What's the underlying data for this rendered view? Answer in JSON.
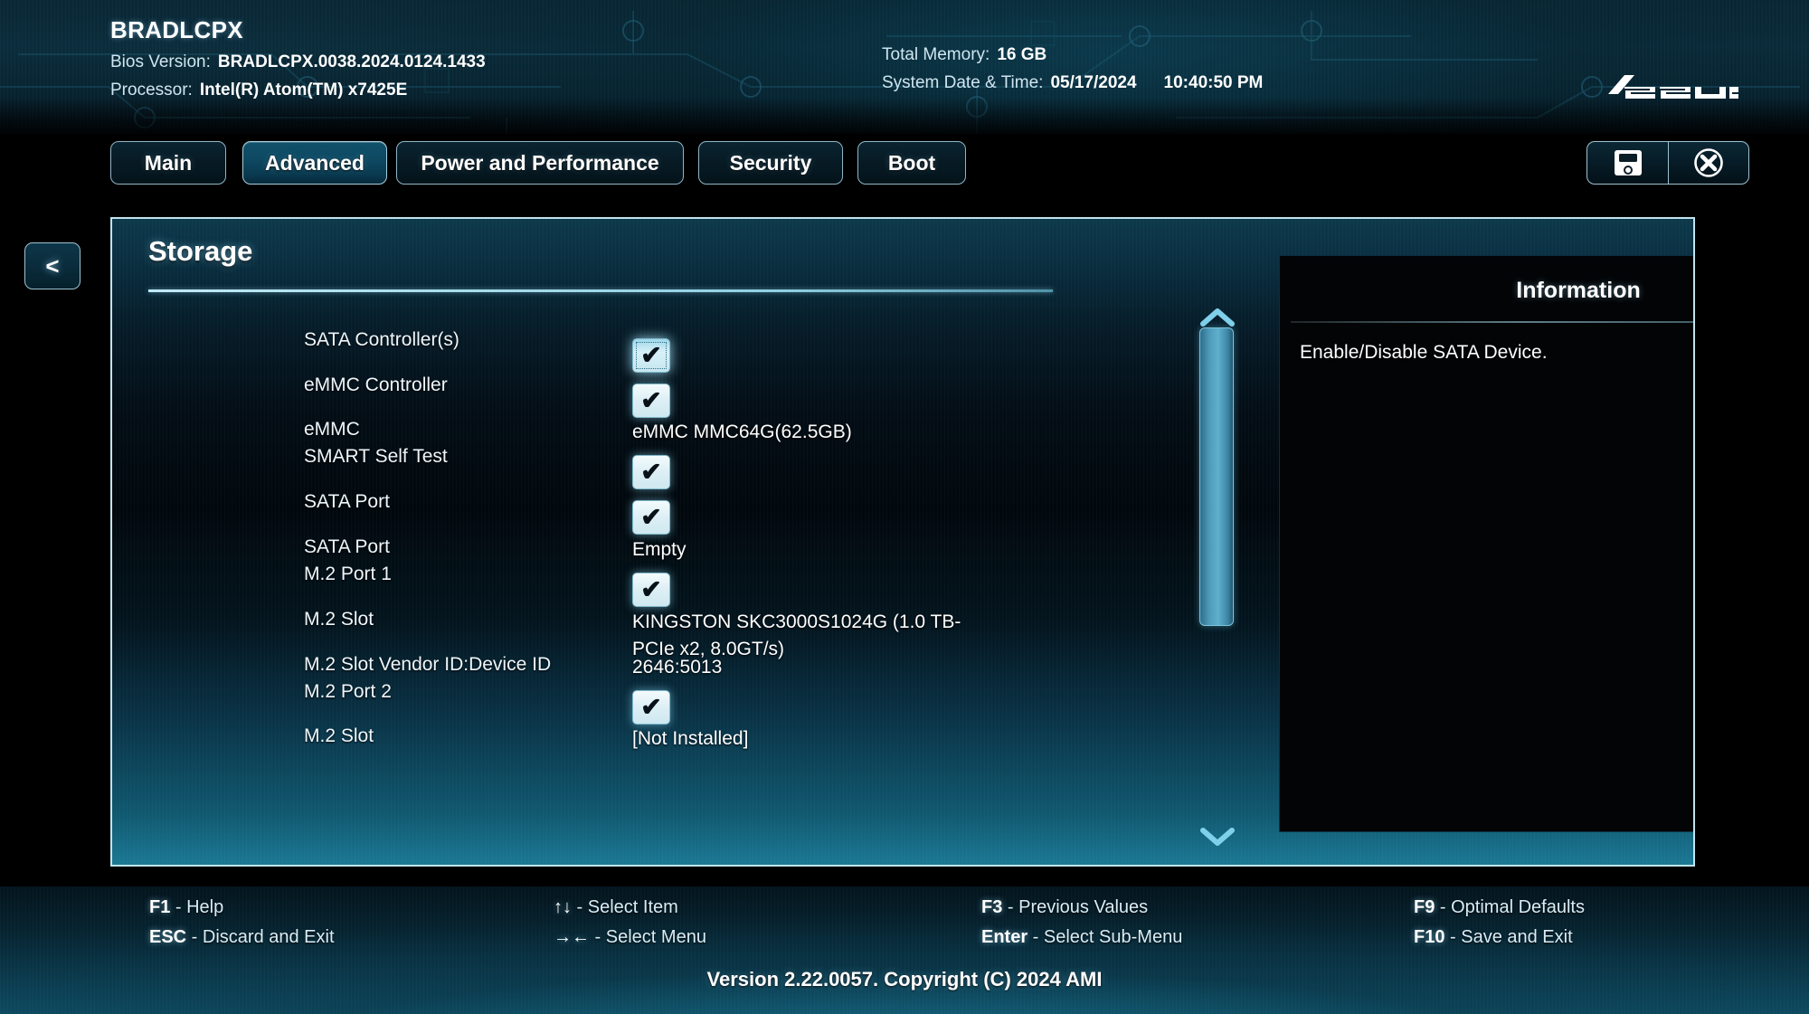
{
  "header": {
    "system_name": "BRADLCPX",
    "bios_version_label": "Bios Version:",
    "bios_version_value": "BRADLCPX.0038.2024.0124.1433",
    "processor_label": "Processor:",
    "processor_value": "Intel(R) Atom(TM) x7425E",
    "total_memory_label": "Total Memory:",
    "total_memory_value": "16 GB",
    "datetime_label": "System Date & Time:",
    "date_value": "05/17/2024",
    "time_value": "10:40:50 PM",
    "brand": "ASUS"
  },
  "tabs": [
    {
      "label": "Main",
      "selected": false
    },
    {
      "label": "Advanced",
      "selected": true
    },
    {
      "label": "Power and Performance",
      "selected": false
    },
    {
      "label": "Security",
      "selected": false
    },
    {
      "label": "Boot",
      "selected": false
    }
  ],
  "toolbar": {
    "save_icon": "save-floppy-icon",
    "close_icon": "close-circle-icon"
  },
  "nav": {
    "back_label": "<"
  },
  "panel": {
    "title": "Storage",
    "rows": [
      {
        "label": "SATA Controller(s)",
        "type": "checkbox",
        "checked": true,
        "focused": true
      },
      {
        "label": "eMMC Controller",
        "type": "checkbox",
        "checked": true,
        "focused": false
      },
      {
        "label": "eMMC",
        "type": "text",
        "value": "eMMC MMC64G(62.5GB)"
      },
      {
        "label": "SMART Self Test",
        "type": "checkbox",
        "checked": true,
        "focused": false
      },
      {
        "label": "SATA Port",
        "type": "checkbox",
        "checked": true,
        "focused": false
      },
      {
        "label": "SATA Port",
        "type": "text",
        "value": "Empty"
      },
      {
        "label": "M.2 Port 1",
        "type": "checkbox",
        "checked": true,
        "focused": false
      },
      {
        "label": "M.2 Slot",
        "type": "text",
        "value": "KINGSTON SKC3000S1024G (1.0 TB-PCIe x2, 8.0GT/s)"
      },
      {
        "label": "M.2 Slot Vendor ID:Device ID",
        "type": "text",
        "value": "2646:5013"
      },
      {
        "label": "M.2 Port 2",
        "type": "checkbox",
        "checked": true,
        "focused": false
      },
      {
        "label": "M.2 Slot",
        "type": "text",
        "value": "[Not Installed]"
      }
    ],
    "checkbox_tick": "✔",
    "scrollbar": {
      "up_icon": "chevron-up-icon",
      "down_icon": "chevron-down-icon"
    }
  },
  "info": {
    "title": "Information",
    "body": "Enable/Disable SATA Device."
  },
  "footer": {
    "hints": [
      [
        {
          "key": "F1",
          "text": " - Help"
        },
        {
          "key": "ESC",
          "text": " - Discard and Exit"
        }
      ],
      [
        {
          "key": "↑↓",
          "text": " - Select Item"
        },
        {
          "key": "→←",
          "text": " - Select Menu"
        }
      ],
      [
        {
          "key": "F3",
          "text": " - Previous Values"
        },
        {
          "key": "Enter",
          "text": " - Select Sub-Menu"
        }
      ],
      [
        {
          "key": "F9",
          "text": " - Optimal Defaults"
        },
        {
          "key": "F10",
          "text": " - Save and Exit"
        }
      ]
    ],
    "version": "Version 2.22.0057. Copyright (C) 2024 AMI"
  },
  "colors": {
    "accent": "#5fb0cd",
    "panel_border": "#bfe4ef",
    "text": "#ffffff"
  }
}
